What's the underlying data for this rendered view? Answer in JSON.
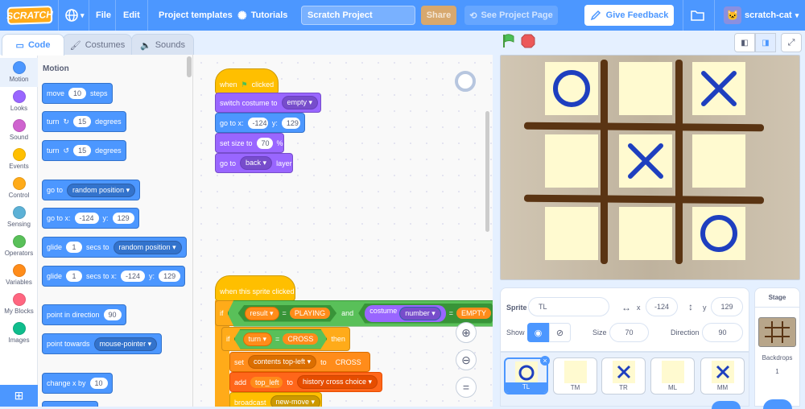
{
  "menubar": {
    "logo": "SCRATCH",
    "file": "File",
    "edit": "Edit",
    "templates": "Project templates",
    "tutorials": "Tutorials",
    "project_title": "Scratch Project",
    "share": "Share",
    "see_project": "See Project Page",
    "feedback": "Give Feedback",
    "username": "scratch-cat"
  },
  "tabs": {
    "code": "Code",
    "costumes": "Costumes",
    "sounds": "Sounds"
  },
  "categories": [
    {
      "label": "Motion",
      "color": "#4c97ff"
    },
    {
      "label": "Looks",
      "color": "#9966ff"
    },
    {
      "label": "Sound",
      "color": "#cf63cf"
    },
    {
      "label": "Events",
      "color": "#ffbf00"
    },
    {
      "label": "Control",
      "color": "#ffab19"
    },
    {
      "label": "Sensing",
      "color": "#5cb1d6"
    },
    {
      "label": "Operators",
      "color": "#59c059"
    },
    {
      "label": "Variables",
      "color": "#ff8c1a"
    },
    {
      "label": "My Blocks",
      "color": "#ff6680"
    },
    {
      "label": "Images",
      "color": "#0fbd8c"
    }
  ],
  "palette": {
    "heading": "Motion",
    "move": "move",
    "move_val": "10",
    "steps": "steps",
    "turn": "turn",
    "turn_r_val": "15",
    "degrees": "degrees",
    "turn_l_val": "15",
    "goto": "go to",
    "goto_opt": "random position",
    "gotoxy": "go to x:",
    "x_val": "-124",
    "y_lbl": "y:",
    "y_val": "129",
    "glide": "glide",
    "glide_val": "1",
    "secs_to": "secs to",
    "glide_opt": "random position",
    "glide2_val": "1",
    "secs_to_x": "secs to x:",
    "glide_x": "-124",
    "glide_y": "129",
    "point_dir": "point in direction",
    "dir_val": "90",
    "point_towards": "point towards",
    "towards_opt": "mouse-pointer",
    "change_x": "change x by",
    "change_x_val": "10"
  },
  "script1": {
    "hat": "when",
    "hat2": "clicked",
    "switch": "switch costume to",
    "switch_opt": "empty",
    "goto": "go to x:",
    "x": "-124",
    "y_lbl": "y:",
    "y": "129",
    "size": "set size to",
    "size_val": "70",
    "pct": "%",
    "layer": "go to",
    "layer_opt": "back",
    "layer_lbl": "layer"
  },
  "script2": {
    "hat": "when this sprite clicked",
    "if": "if",
    "result": "result",
    "eq": "=",
    "playing": "PLAYING",
    "and": "and",
    "costume": "costume",
    "number": "number",
    "eq2": "=",
    "empty": "EMPTY",
    "if2": "if",
    "turn": "turn",
    "eq3": "=",
    "cross": "CROSS",
    "then": "then",
    "set": "set",
    "contents": "contents top-left",
    "to": "to",
    "cross2": "CROSS",
    "add": "add",
    "top_left": "top_left",
    "to2": "to",
    "history": "history cross choice",
    "broadcast": "broadcast",
    "msg": "new-move"
  },
  "sprite_info": {
    "sprite_lbl": "Sprite",
    "name": "TL",
    "x_lbl": "x",
    "x": "-124",
    "y_lbl": "y",
    "y": "129",
    "show_lbl": "Show",
    "size_lbl": "Size",
    "size": "70",
    "dir_lbl": "Direction",
    "dir": "90"
  },
  "sprites": [
    {
      "name": "TL",
      "mark": "O"
    },
    {
      "name": "TM",
      "mark": ""
    },
    {
      "name": "TR",
      "mark": "X"
    },
    {
      "name": "ML",
      "mark": ""
    },
    {
      "name": "MM",
      "mark": "X"
    }
  ],
  "stage_panel": {
    "title": "Stage",
    "backdrops": "Backdrops",
    "count": "1"
  },
  "board": [
    "O",
    "",
    "X",
    "",
    "X",
    "",
    "",
    "",
    "O"
  ],
  "colors": {
    "accent": "#4c97ff",
    "mark": "#1e3fbf",
    "cell": "#fffad0",
    "line": "#5a3413"
  }
}
